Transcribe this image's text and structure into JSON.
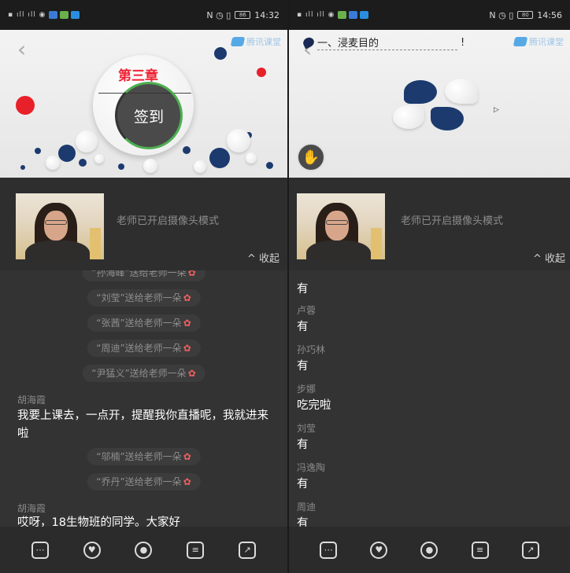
{
  "left": {
    "status": {
      "time": "14:32",
      "battery": "86"
    },
    "slide": {
      "brand": "腾讯课堂",
      "chapter": "第三章",
      "signin_label": "签到"
    },
    "camera": {
      "status_text": "老师已开启摄像头模式",
      "collapse_label": "^ 收起"
    },
    "chat": {
      "gifts": [
        {
          "text": "“刘莹”送给老师一朵"
        },
        {
          "text": "“张茜”送给老师一朵"
        },
        {
          "text": "“周迪”送给老师一朵"
        },
        {
          "text": "“尹猛义”送给老师一朵"
        },
        {
          "text": "“邬楠”送给老师一朵"
        },
        {
          "text": "“乔丹”送给老师一朵"
        }
      ],
      "messages": [
        {
          "name": "胡海霞",
          "text": "我要上课去，一点开，提醒我你直播呢，我就进来啦"
        },
        {
          "name": "胡海霞",
          "text": "哎呀，18生物班的同学。大家好"
        }
      ]
    }
  },
  "right": {
    "status": {
      "time": "14:56",
      "battery": "80"
    },
    "slide": {
      "brand": "腾讯课堂",
      "title": "一、浸麦目的",
      "mark": "!"
    },
    "camera": {
      "status_text": "老师已开启摄像头模式",
      "collapse_label": "^ 收起"
    },
    "answers": [
      {
        "name": "",
        "text": "有"
      },
      {
        "name": "卢蓉",
        "text": "有"
      },
      {
        "name": "孙巧林",
        "text": "有"
      },
      {
        "name": "步娜",
        "text": "吃完啦"
      },
      {
        "name": "刘莹",
        "text": "有"
      },
      {
        "name": "冯逸陶",
        "text": "有"
      },
      {
        "name": "周迪",
        "text": "有"
      }
    ]
  },
  "icons": {
    "flower": "✿"
  },
  "colors": {
    "accent_green": "#4caf50",
    "dot_blue": "#1c3a6e",
    "dot_red": "#e8202a"
  }
}
